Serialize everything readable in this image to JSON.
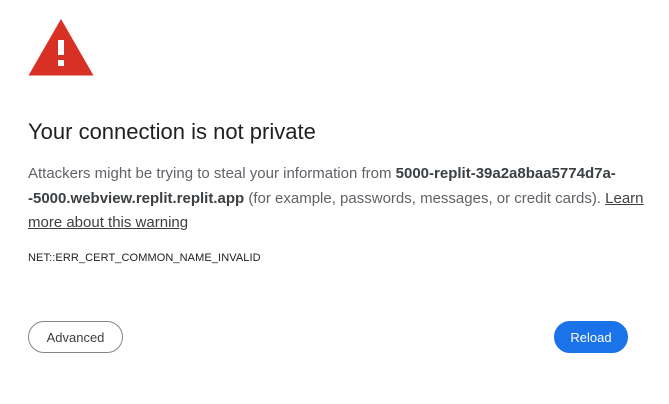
{
  "icon": {
    "name": "warning-triangle-icon",
    "color": "#d93025",
    "mark_color": "#ffffff"
  },
  "title": "Your connection is not private",
  "explanation": {
    "prefix": "Attackers might be trying to steal your information from ",
    "host": "5000-replit-39a2a8baa5774d7a--5000.webview.replit.replit.app",
    "suffix": " (for example, passwords, messages, or credit cards). ",
    "learn_more": "Learn more about this warning"
  },
  "error_code": "NET::ERR_CERT_COMMON_NAME_INVALID",
  "buttons": {
    "advanced": "Advanced",
    "reload": "Reload"
  },
  "colors": {
    "primary": "#1a73e8",
    "danger": "#d93025"
  }
}
